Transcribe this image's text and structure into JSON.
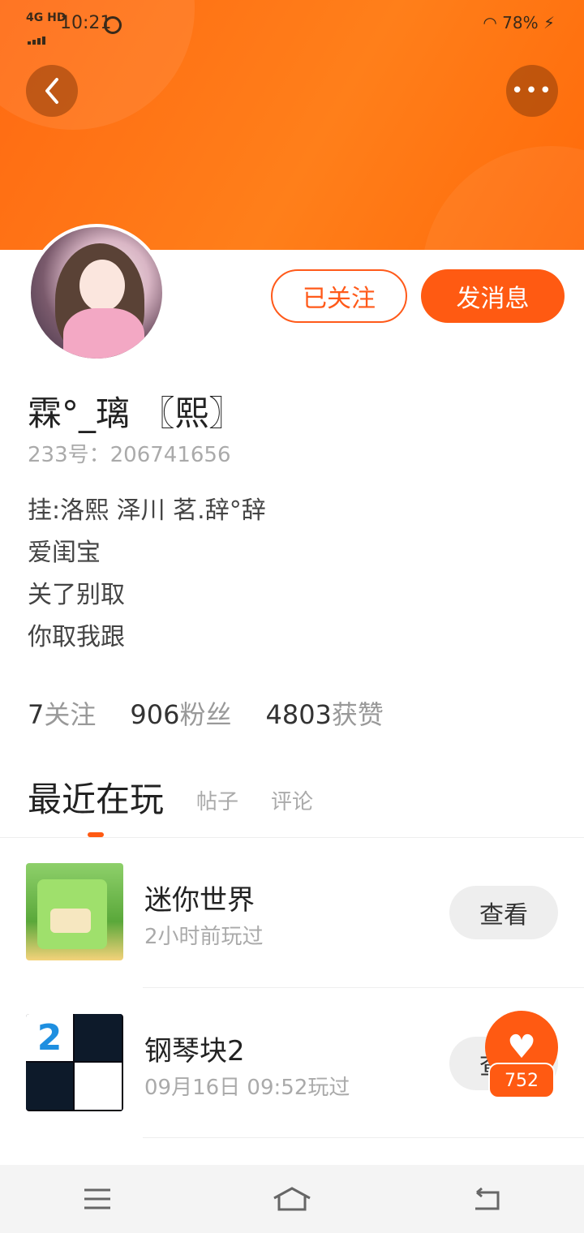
{
  "status_bar": {
    "network": "4G HD",
    "time": "10:21",
    "battery": "78%"
  },
  "profile": {
    "username": "霖°_璃 〖熙〗",
    "uid": "233号：206741656",
    "bio": [
      "挂:洛熙  泽川  茗.辞°辞",
      "爱闺宝",
      "关了别取",
      "你取我跟"
    ],
    "following_button": "已关注",
    "message_button": "发消息",
    "stats": [
      {
        "value": "7",
        "label": "关注"
      },
      {
        "value": "906",
        "label": "粉丝"
      },
      {
        "value": "4803",
        "label": "获赞"
      }
    ]
  },
  "tabs": {
    "active": "最近在玩",
    "posts": "帖子",
    "comments": "评论"
  },
  "games": [
    {
      "title": "迷你世界",
      "subtitle": "2小时前玩过",
      "action": "查看"
    },
    {
      "title": "钢琴块2",
      "subtitle": "09月16日 09:52玩过",
      "action": "查看"
    }
  ],
  "like_badge": "752",
  "icons": {
    "back": "chevron-left-icon",
    "more": "more-icon",
    "like": "heart-icon",
    "nav_menu": "menu-icon",
    "nav_home": "home-icon",
    "nav_back": "back-icon"
  },
  "colors": {
    "accent": "#ff5a12",
    "header": "#ff7a1a"
  }
}
